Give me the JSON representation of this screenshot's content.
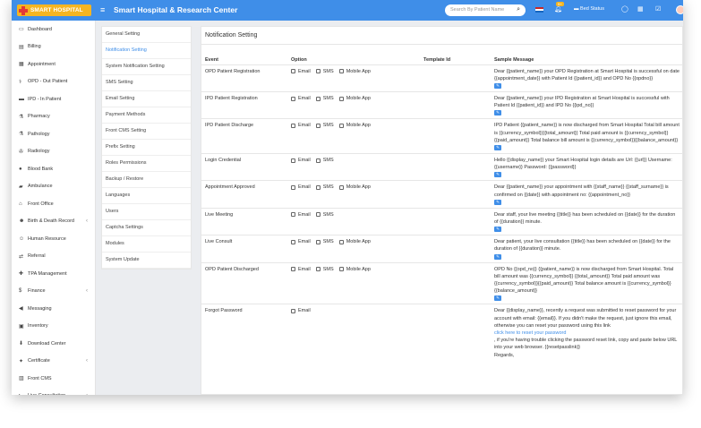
{
  "header": {
    "logo_text": "SMART HOSPITAL",
    "app_title": "Smart Hospital & Research Center",
    "search_placeholder": "Search By Patient Name",
    "notification_count": "9+",
    "bed_status": "Bed Status",
    "colors": {
      "topbar": "#3f8ee8",
      "logo": "#f5b521"
    }
  },
  "sidebar": {
    "items": [
      {
        "label": "Dashboard",
        "icon": "monitor-icon"
      },
      {
        "label": "Billing",
        "icon": "billing-icon"
      },
      {
        "label": "Appointment",
        "icon": "calendar-icon"
      },
      {
        "label": "OPD - Out Patient",
        "icon": "stethoscope-icon"
      },
      {
        "label": "IPD - In Patient",
        "icon": "bed-icon"
      },
      {
        "label": "Pharmacy",
        "icon": "mortar-icon"
      },
      {
        "label": "Pathology",
        "icon": "flask-icon"
      },
      {
        "label": "Radiology",
        "icon": "microscope-icon"
      },
      {
        "label": "Blood Bank",
        "icon": "blood-drop-icon"
      },
      {
        "label": "Ambulance",
        "icon": "ambulance-icon"
      },
      {
        "label": "Front Office",
        "icon": "front-office-icon"
      },
      {
        "label": "Birth & Death Record",
        "icon": "family-icon",
        "chevron": "‹"
      },
      {
        "label": "Human Resource",
        "icon": "users-icon"
      },
      {
        "label": "Referral",
        "icon": "referral-icon"
      },
      {
        "label": "TPA Management",
        "icon": "tpa-icon"
      },
      {
        "label": "Finance",
        "icon": "money-icon",
        "chevron": "‹"
      },
      {
        "label": "Messaging",
        "icon": "megaphone-icon"
      },
      {
        "label": "Inventory",
        "icon": "inventory-icon"
      },
      {
        "label": "Download Center",
        "icon": "download-icon"
      },
      {
        "label": "Certificate",
        "icon": "certificate-icon",
        "chevron": "‹"
      },
      {
        "label": "Front CMS",
        "icon": "cms-icon"
      },
      {
        "label": "Live Consultation",
        "icon": "video-icon",
        "chevron": "‹"
      }
    ]
  },
  "settings_menu": {
    "items": [
      {
        "label": "General Setting"
      },
      {
        "label": "Notification Setting",
        "active": true
      },
      {
        "label": "System Notification Setting"
      },
      {
        "label": "SMS Setting"
      },
      {
        "label": "Email Setting"
      },
      {
        "label": "Payment Methods"
      },
      {
        "label": "Front CMS Setting"
      },
      {
        "label": "Prefix Setting"
      },
      {
        "label": "Roles Permissions"
      },
      {
        "label": "Backup / Restore"
      },
      {
        "label": "Languages"
      },
      {
        "label": "Users"
      },
      {
        "label": "Captcha Settings"
      },
      {
        "label": "Modules"
      },
      {
        "label": "System Update"
      }
    ]
  },
  "main": {
    "title": "Notification Setting",
    "columns": {
      "event": "Event",
      "option": "Option",
      "template_id": "Template Id",
      "sample": "Sample Message"
    },
    "option_labels": {
      "email": "Email",
      "sms": "SMS",
      "mobile": "Mobile App"
    },
    "rows": [
      {
        "event": "OPD Patient Registration",
        "options": [
          "email",
          "sms",
          "mobile"
        ],
        "message": "Dear {{patient_name}} your OPD Registration at Smart Hospital is successful on date {{appointment_date}} with Patient Id {{patient_id}} and OPD No {{opdno}}"
      },
      {
        "event": "IPD Patient Registration",
        "options": [
          "email",
          "sms",
          "mobile"
        ],
        "message": "Dear {{patient_name}} your IPD Registration at Smart Hospital is successful with Patient Id {{patient_id}} and IPD No {{ipd_no}}"
      },
      {
        "event": "IPD Patient Discharge",
        "options": [
          "email",
          "sms",
          "mobile"
        ],
        "message": "IPD Patient {{patient_name}} is now discharged from Smart Hospital Total bill amount is {{currency_symbol}}{{total_amount}} Total paid amount is {{currency_symbol}}{{paid_amount}} Total balance bill amount is {{currency_symbol}}{{balance_amount}}"
      },
      {
        "event": "Login Credential",
        "options": [
          "email",
          "sms"
        ],
        "message": "Hello {{display_name}} your Smart Hospital login details are Url: {{url}} Username: {{username}} Password: {{password}}"
      },
      {
        "event": "Appointment Approved",
        "options": [
          "email",
          "sms",
          "mobile"
        ],
        "message": "Dear {{patient_name}} your appointment with {{staff_name}} {{staff_surname}} is confirmed on {{date}} with appointment no: {{appointment_no}}"
      },
      {
        "event": "Live Meeting",
        "options": [
          "email",
          "sms"
        ],
        "message": "Dear staff, your live meeting {{title}} has been scheduled on {{date}} for the duration of {{duration}} minute."
      },
      {
        "event": "Live Consult",
        "options": [
          "email",
          "sms",
          "mobile"
        ],
        "message": "Dear patient, your live consultation {{title}} has been scheduled on {{date}} for the duration of {{duration}} minute."
      },
      {
        "event": "OPD Patient Discharged",
        "options": [
          "email",
          "sms",
          "mobile"
        ],
        "message": "OPD No {{opd_no}} {{patient_name}} is now discharged from Smart Hospital. Total bill amount was {{currency_symbol}} {{total_amount}} Total paid amount was {{currency_symbol}}{{paid_amount}} Total balance amount is {{currency_symbol}}{{balance_amount}}"
      },
      {
        "event": "Forgot Password",
        "options": [
          "email"
        ],
        "message": "Dear {{display_name}}, recently a request was submitted to reset password for your account with email: {{email}}. If you didn't make the request, just ignore this email, otherwise you can reset your password using this link",
        "link": "click here to reset your password",
        "message_after": ", if you're having trouble clicking the password reset link, copy and paste below URL into your web browser. {{resetpasslink}}",
        "message_end": "Regards,"
      }
    ]
  }
}
